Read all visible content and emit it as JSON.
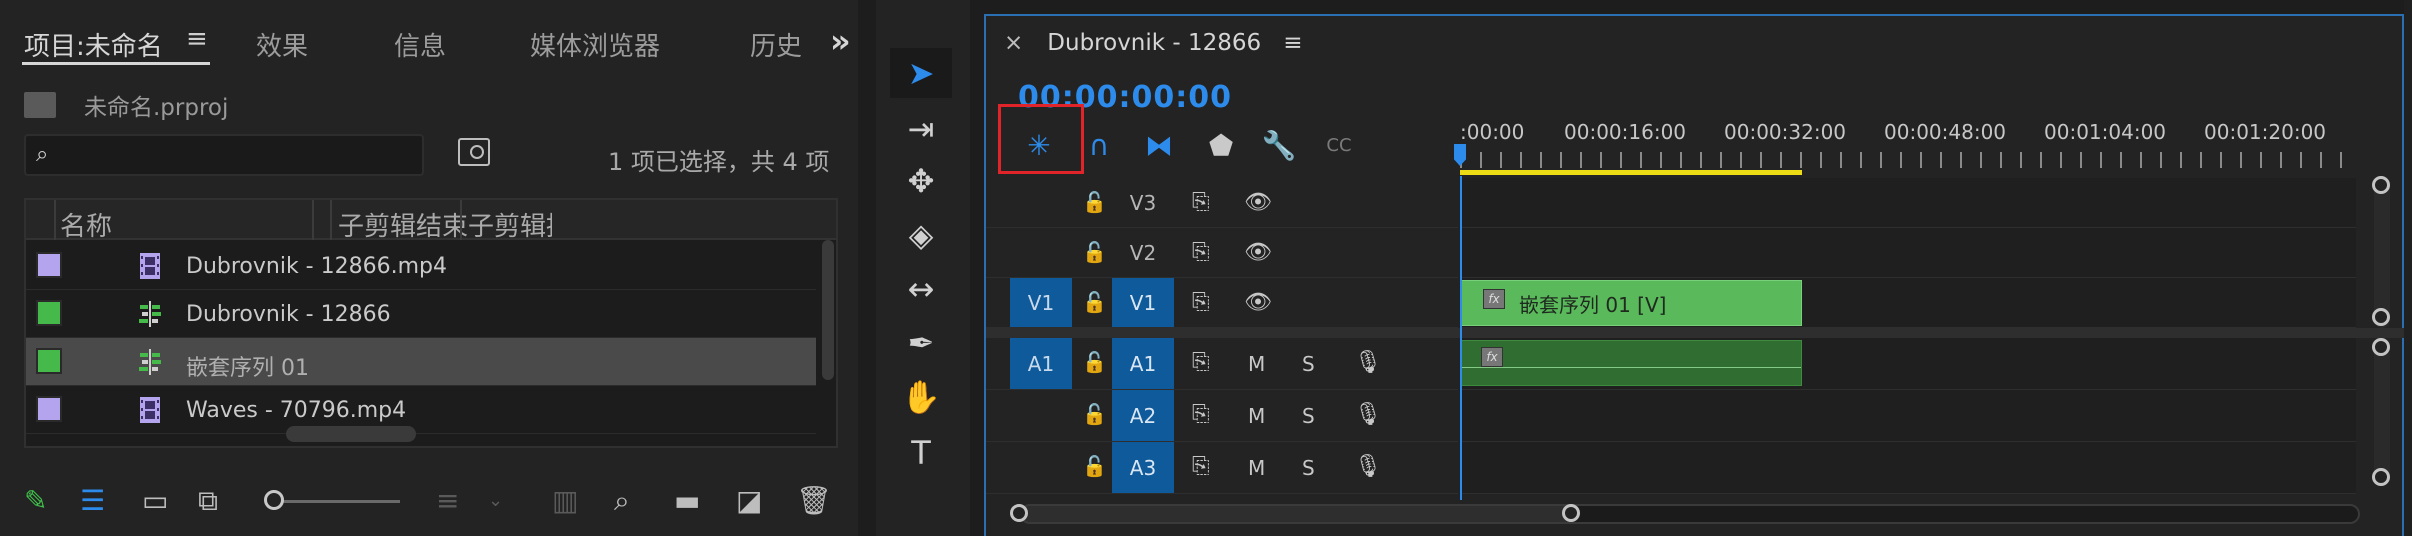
{
  "project": {
    "tabs": [
      {
        "label": "项目:未命名",
        "active": true
      },
      {
        "label": "效果"
      },
      {
        "label": "信息"
      },
      {
        "label": "媒体浏览器"
      },
      {
        "label": "历史"
      }
    ],
    "file_name": "未命名.prproj",
    "search_placeholder": "",
    "selection_info": "1 项已选择，共 4 项",
    "columns": [
      "名称",
      "子剪辑结束",
      "子剪辑持续"
    ],
    "items": [
      {
        "name": "Dubrovnik - 12866.mp4",
        "color": "#b4a4ee",
        "type": "video-clip",
        "selected": false
      },
      {
        "name": "Dubrovnik - 12866",
        "color": "#46b94b",
        "type": "sequence",
        "selected": false
      },
      {
        "name": "嵌套序列 01",
        "color": "#46b94b",
        "type": "sequence",
        "selected": true
      },
      {
        "name": "Waves - 70796.mp4",
        "color": "#b4a4ee",
        "type": "video-clip",
        "selected": false
      }
    ],
    "footer_icons": [
      "pencil-icon",
      "list-view-icon",
      "icon-view-icon",
      "freeform-view-icon",
      "zoom-slider",
      "sort-icon",
      "automate-icon",
      "find-icon",
      "new-bin-icon",
      "new-item-icon",
      "clear-icon"
    ]
  },
  "tools": [
    "selection-tool",
    "track-select-forward-tool",
    "ripple-edit-tool",
    "razor-tool",
    "slip-tool",
    "pen-tool",
    "hand-tool",
    "type-tool"
  ],
  "timeline": {
    "title": "Dubrovnik - 12866",
    "close_glyph": "×",
    "menu_glyph": "≡",
    "timecode": "00:00:00:00",
    "toolbar": [
      "insert-nest-icon",
      "snap-magnet-icon",
      "linked-selection-icon",
      "add-marker-icon",
      "settings-wrench-icon",
      "captions-icon"
    ],
    "ruler_labels": [
      ":00:00",
      "00:00:16:00",
      "00:00:32:00",
      "00:00:48:00",
      "00:01:04:00",
      "00:01:20:00"
    ],
    "video_tracks": [
      {
        "label": "V3",
        "source": ""
      },
      {
        "label": "V2",
        "source": ""
      },
      {
        "label": "V1",
        "source": "V1"
      }
    ],
    "audio_tracks": [
      {
        "label": "A1",
        "source": "A1",
        "m": "M",
        "s": "S"
      },
      {
        "label": "A2",
        "source": "",
        "m": "M",
        "s": "S"
      },
      {
        "label": "A3",
        "source": "",
        "m": "M",
        "s": "S"
      }
    ],
    "video_clip": {
      "name": "嵌套序列 01 [V]",
      "fx": "fx"
    },
    "audio_clip": {
      "fx": "fx"
    }
  }
}
